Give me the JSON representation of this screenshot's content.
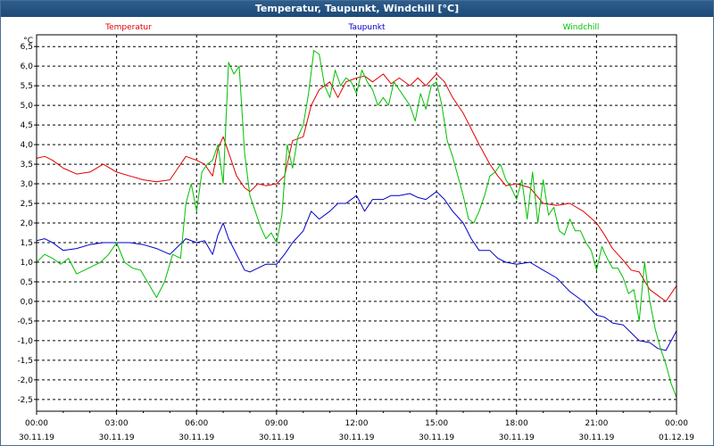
{
  "window": {
    "title": "Temperatur, Taupunkt, Windchill [°C]"
  },
  "chart_data": {
    "type": "line",
    "title": "Temperatur, Taupunkt, Windchill [°C]",
    "ylabel": "°C",
    "ylim": [
      -2.8,
      6.8
    ],
    "xlim": [
      0,
      24
    ],
    "grid": true,
    "legend_position": "top",
    "y_ticks": [
      "6,5",
      "6,0",
      "5,5",
      "5,0",
      "4,5",
      "4,0",
      "3,5",
      "3,0",
      "2,5",
      "2,0",
      "1,5",
      "1,0",
      "0,5",
      "0,0",
      "-0,5",
      "-1,0",
      "-1,5",
      "-2,0",
      "-2,5"
    ],
    "x_ticks": [
      {
        "time": "00:00",
        "date": "30.11.19"
      },
      {
        "time": "03:00",
        "date": "30.11.19"
      },
      {
        "time": "06:00",
        "date": "30.11.19"
      },
      {
        "time": "09:00",
        "date": "30.11.19"
      },
      {
        "time": "12:00",
        "date": "30.11.19"
      },
      {
        "time": "15:00",
        "date": "30.11.19"
      },
      {
        "time": "18:00",
        "date": "30.11.19"
      },
      {
        "time": "21:00",
        "date": "30.11.19"
      },
      {
        "time": "00:00",
        "date": "01.12.19"
      }
    ],
    "series": [
      {
        "name": "Temperatur",
        "color": "#e00000",
        "x": [
          0,
          0.3,
          0.6,
          1,
          1.5,
          2,
          2.5,
          3,
          3.5,
          4,
          4.5,
          5,
          5.3,
          5.6,
          6,
          6.3,
          6.6,
          6.8,
          7,
          7.2,
          7.5,
          7.8,
          8,
          8.3,
          8.6,
          9,
          9.3,
          9.6,
          10,
          10.3,
          10.6,
          11,
          11.3,
          11.6,
          12,
          12.3,
          12.6,
          13,
          13.3,
          13.6,
          14,
          14.3,
          14.6,
          15,
          15.3,
          15.6,
          16,
          16.3,
          16.6,
          17,
          17.3,
          17.6,
          18,
          18.5,
          19,
          19.5,
          20,
          20.5,
          21,
          21.3,
          21.6,
          22,
          22.3,
          22.6,
          23,
          23.3,
          23.6,
          24
        ],
        "y": [
          3.65,
          3.7,
          3.6,
          3.4,
          3.25,
          3.3,
          3.5,
          3.3,
          3.2,
          3.1,
          3.05,
          3.1,
          3.4,
          3.7,
          3.6,
          3.5,
          3.2,
          3.9,
          4.2,
          3.8,
          3.2,
          2.9,
          2.8,
          3.0,
          2.95,
          3.0,
          3.2,
          4.1,
          4.2,
          5.0,
          5.4,
          5.6,
          5.2,
          5.6,
          5.7,
          5.75,
          5.6,
          5.8,
          5.55,
          5.7,
          5.5,
          5.7,
          5.5,
          5.8,
          5.6,
          5.2,
          4.8,
          4.4,
          4.0,
          3.5,
          3.2,
          2.95,
          3.0,
          2.9,
          2.5,
          2.45,
          2.5,
          2.3,
          2.0,
          1.7,
          1.35,
          1.05,
          0.8,
          0.75,
          0.3,
          0.15,
          0.0,
          0.4
        ]
      },
      {
        "name": "Taupunkt",
        "color": "#0000c8",
        "x": [
          0,
          0.3,
          0.6,
          1,
          1.5,
          2,
          2.5,
          3,
          3.5,
          4,
          4.5,
          5,
          5.3,
          5.6,
          6,
          6.3,
          6.6,
          6.8,
          7,
          7.2,
          7.5,
          7.8,
          8,
          8.3,
          8.6,
          9,
          9.3,
          9.6,
          10,
          10.3,
          10.6,
          11,
          11.3,
          11.6,
          12,
          12.3,
          12.6,
          13,
          13.3,
          13.6,
          14,
          14.3,
          14.6,
          15,
          15.3,
          15.6,
          16,
          16.3,
          16.6,
          17,
          17.3,
          17.6,
          18,
          18.5,
          19,
          19.5,
          20,
          20.5,
          21,
          21.3,
          21.6,
          22,
          22.3,
          22.6,
          23,
          23.3,
          23.6,
          24
        ],
        "y": [
          1.55,
          1.6,
          1.5,
          1.3,
          1.35,
          1.45,
          1.5,
          1.5,
          1.5,
          1.45,
          1.35,
          1.2,
          1.4,
          1.6,
          1.5,
          1.55,
          1.2,
          1.7,
          2.0,
          1.6,
          1.2,
          0.8,
          0.75,
          0.85,
          0.95,
          0.95,
          1.2,
          1.5,
          1.8,
          2.3,
          2.1,
          2.3,
          2.5,
          2.5,
          2.7,
          2.3,
          2.6,
          2.6,
          2.7,
          2.7,
          2.75,
          2.65,
          2.6,
          2.8,
          2.6,
          2.3,
          2.0,
          1.6,
          1.3,
          1.3,
          1.1,
          1.0,
          0.95,
          1.0,
          0.8,
          0.6,
          0.25,
          0.0,
          -0.35,
          -0.4,
          -0.55,
          -0.6,
          -0.8,
          -1.0,
          -1.05,
          -1.2,
          -1.25,
          -0.75
        ]
      },
      {
        "name": "Windchill",
        "color": "#00c000",
        "x": [
          0,
          0.3,
          0.6,
          0.9,
          1.2,
          1.5,
          1.8,
          2.1,
          2.4,
          2.7,
          3,
          3.3,
          3.6,
          3.9,
          4.2,
          4.5,
          4.8,
          5.1,
          5.4,
          5.6,
          5.8,
          6,
          6.2,
          6.4,
          6.6,
          6.8,
          7,
          7.2,
          7.4,
          7.6,
          7.8,
          8,
          8.2,
          8.4,
          8.6,
          8.8,
          9,
          9.2,
          9.4,
          9.6,
          9.8,
          10,
          10.2,
          10.4,
          10.6,
          10.8,
          11,
          11.2,
          11.4,
          11.6,
          11.8,
          12,
          12.2,
          12.4,
          12.6,
          12.8,
          13,
          13.2,
          13.4,
          13.6,
          13.8,
          14,
          14.2,
          14.4,
          14.6,
          14.8,
          15,
          15.2,
          15.4,
          15.6,
          15.8,
          16,
          16.2,
          16.4,
          16.6,
          16.8,
          17,
          17.2,
          17.4,
          17.6,
          17.8,
          18,
          18.2,
          18.4,
          18.6,
          18.8,
          19,
          19.2,
          19.4,
          19.6,
          19.8,
          20,
          20.2,
          20.4,
          20.6,
          20.8,
          21,
          21.2,
          21.4,
          21.6,
          21.8,
          22,
          22.2,
          22.4,
          22.6,
          22.8,
          23,
          23.2,
          23.4,
          23.6,
          23.8,
          24
        ],
        "y": [
          1.0,
          1.2,
          1.1,
          0.95,
          1.1,
          0.7,
          0.8,
          0.9,
          1.0,
          1.2,
          1.5,
          1.0,
          0.85,
          0.8,
          0.45,
          0.1,
          0.5,
          1.2,
          1.1,
          2.5,
          3.0,
          2.3,
          3.3,
          3.5,
          3.6,
          4.0,
          3.0,
          6.1,
          5.8,
          6.0,
          3.8,
          2.7,
          2.3,
          1.9,
          1.6,
          1.75,
          1.5,
          2.2,
          4.0,
          3.4,
          4.2,
          4.5,
          5.3,
          6.4,
          6.3,
          5.5,
          5.2,
          5.9,
          5.5,
          5.7,
          5.6,
          5.3,
          5.9,
          5.6,
          5.4,
          5.0,
          5.2,
          5.0,
          5.6,
          5.4,
          5.2,
          5.0,
          4.6,
          5.3,
          4.9,
          5.5,
          5.6,
          5.0,
          4.1,
          3.7,
          3.2,
          2.7,
          2.1,
          2.0,
          2.3,
          2.7,
          3.2,
          3.3,
          3.5,
          3.1,
          2.9,
          2.6,
          3.1,
          2.1,
          3.3,
          2.0,
          3.1,
          2.2,
          2.4,
          1.8,
          1.7,
          2.1,
          1.8,
          1.8,
          1.5,
          1.3,
          0.8,
          1.4,
          1.1,
          0.85,
          0.85,
          0.6,
          0.2,
          0.3,
          -0.5,
          1.0,
          0.0,
          -0.7,
          -1.2,
          -1.6,
          -2.1,
          -2.45
        ]
      }
    ]
  }
}
